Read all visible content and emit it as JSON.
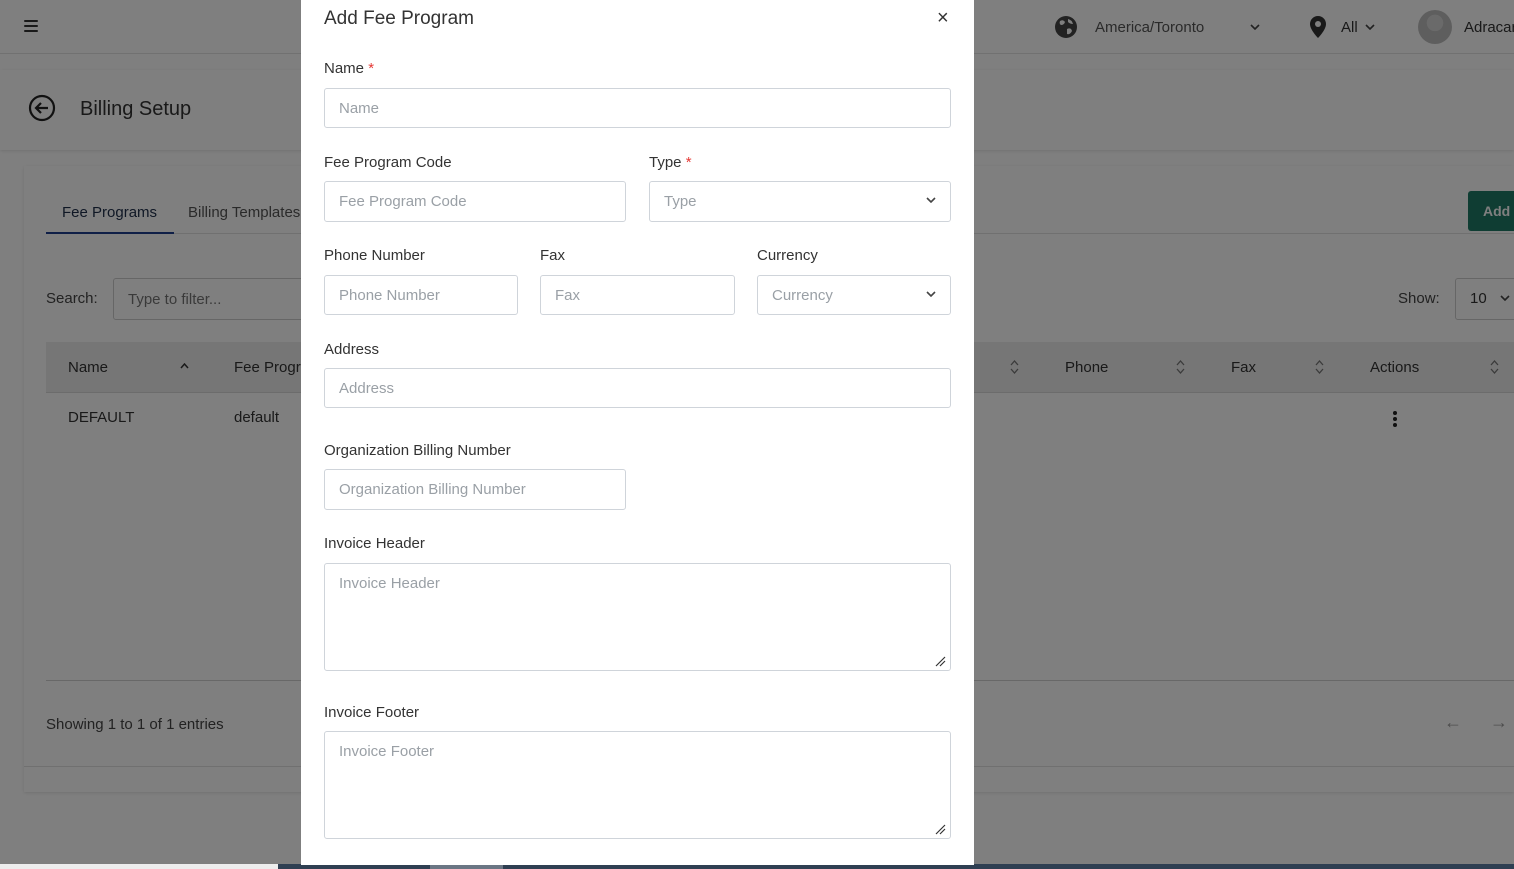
{
  "header": {
    "timezone": "America/Toronto",
    "location": "All",
    "user_name": "Adracar"
  },
  "page": {
    "title": "Billing Setup"
  },
  "tabs": [
    {
      "label": "Fee Programs"
    },
    {
      "label": "Billing Templates"
    }
  ],
  "toolbar": {
    "add_label": "Add",
    "search_label": "Search:",
    "search_placeholder": "Type to filter...",
    "show_label": "Show:",
    "show_value": "10"
  },
  "table": {
    "columns": [
      "Name",
      "Fee Progra",
      "Phone",
      "Fax",
      "Actions"
    ],
    "rows": [
      {
        "name": "DEFAULT",
        "fee_program": "default"
      }
    ],
    "entries_text": "Showing 1 to 1 of 1 entries",
    "prev": "←",
    "next": "→"
  },
  "modal": {
    "title": "Add Fee Program",
    "close": "×",
    "required_mark": "*",
    "fields": {
      "name": {
        "label": "Name",
        "placeholder": "Name"
      },
      "code": {
        "label": "Fee Program Code",
        "placeholder": "Fee Program Code"
      },
      "type": {
        "label": "Type",
        "placeholder": "Type"
      },
      "phone": {
        "label": "Phone Number",
        "placeholder": "Phone Number"
      },
      "fax": {
        "label": "Fax",
        "placeholder": "Fax"
      },
      "currency": {
        "label": "Currency",
        "placeholder": "Currency"
      },
      "address": {
        "label": "Address",
        "placeholder": "Address"
      },
      "org_billing": {
        "label": "Organization Billing Number",
        "placeholder": "Organization Billing Number"
      },
      "invoice_header": {
        "label": "Invoice Header",
        "placeholder": "Invoice Header"
      },
      "invoice_footer": {
        "label": "Invoice Footer",
        "placeholder": "Invoice Footer"
      }
    }
  },
  "colors": {
    "accent": "#1f7a66",
    "tab_underline": "#1f3f8f",
    "required": "#e53935"
  }
}
